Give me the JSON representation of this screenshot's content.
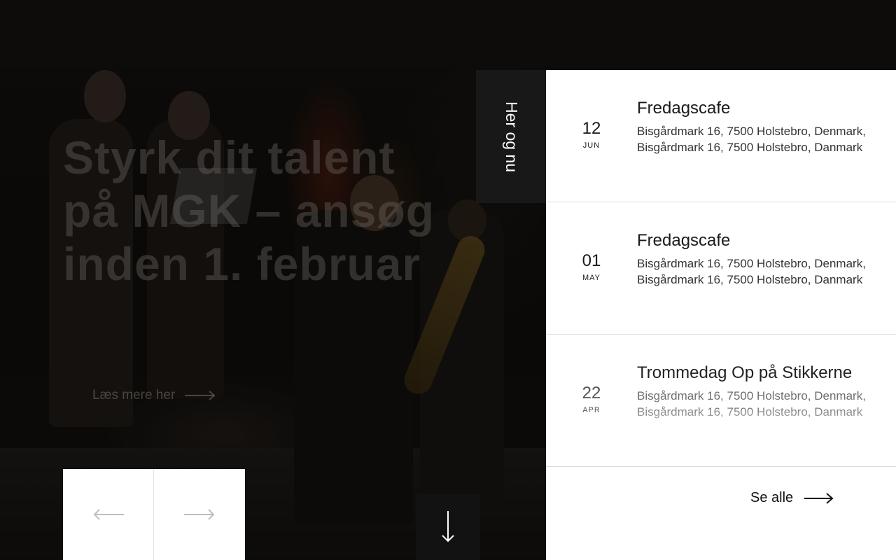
{
  "hero": {
    "title": "Styrk dit talent på MGK – ansøg inden 1. februar",
    "read_more_label": "Læs mere her"
  },
  "side_tab": {
    "label": "Her og nu"
  },
  "events": [
    {
      "day": "12",
      "month": "JUN",
      "title": "Fredagscafe",
      "address": "Bisgårdmark 16, 7500 Holstebro, Denmark, Bisgårdmark 16, 7500 Holstebro, Danmark"
    },
    {
      "day": "01",
      "month": "MAY",
      "title": "Fredagscafe",
      "address": "Bisgårdmark 16, 7500 Holstebro, Denmark, Bisgårdmark 16, 7500 Holstebro, Danmark"
    },
    {
      "day": "22",
      "month": "APR",
      "title": "Trommedag Op på Stikkerne",
      "address": "Bisgårdmark 16, 7500 Holstebro, Denmark, Bisgårdmark 16, 7500 Holstebro, Danmark"
    }
  ],
  "see_all_label": "Se alle",
  "icons": {
    "prev": "arrow-left-icon",
    "next": "arrow-right-icon",
    "scroll": "arrow-down-icon",
    "see_all": "arrow-right-icon"
  },
  "colors": {
    "panel_bg": "#ffffff",
    "tab_bg": "#181818",
    "text_dark": "#1a1a1a"
  }
}
